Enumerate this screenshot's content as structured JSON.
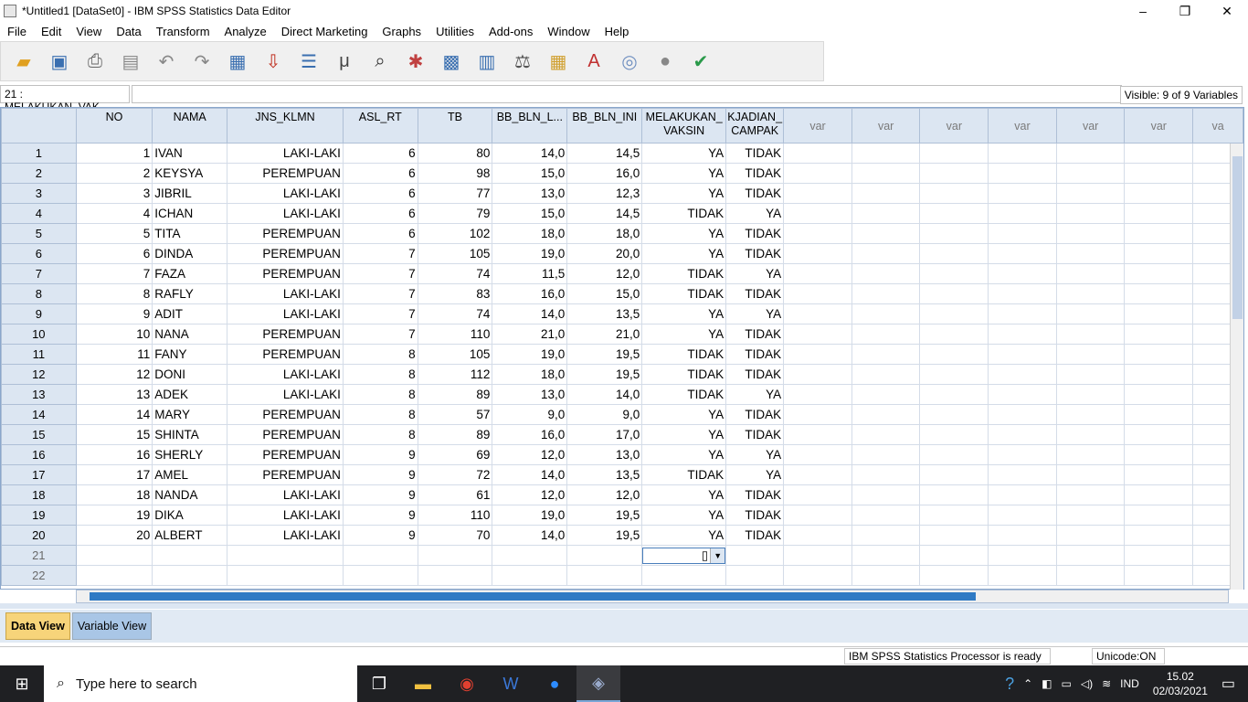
{
  "window": {
    "title": "*Untitled1 [DataSet0] - IBM SPSS Statistics Data Editor",
    "minimize": "–",
    "restore": "❐",
    "close": "✕"
  },
  "menu": [
    "File",
    "Edit",
    "View",
    "Data",
    "Transform",
    "Analyze",
    "Direct Marketing",
    "Graphs",
    "Utilities",
    "Add-ons",
    "Window",
    "Help"
  ],
  "toolbar_icons": [
    "open-folder-icon",
    "save-icon",
    "print-icon",
    "dialog-recall-icon",
    "undo-icon",
    "redo-icon",
    "goto-case-icon",
    "goto-variable-icon",
    "variables-icon",
    "run-descriptives-icon",
    "find-icon",
    "insert-cases-icon",
    "insert-variable-icon",
    "split-file-icon",
    "weight-cases-icon",
    "select-cases-icon",
    "value-labels-icon",
    "use-variable-sets-icon",
    "show-all-variables-icon",
    "spell-check-icon"
  ],
  "cellbar": {
    "ref": "21 : MELAKUKAN_VAK...",
    "value": "",
    "visible": "Visible: 9 of 9 Variables"
  },
  "columns": [
    "NO",
    "NAMA",
    "JNS_KLMN",
    "ASL_RT",
    "TB",
    "BB_BLN_L...",
    "BB_BLN_INI",
    "MELAKUKAN_\nVAKSIN",
    "KJADIAN_\nCAMPAK",
    "var",
    "var",
    "var",
    "var",
    "var",
    "var",
    "va"
  ],
  "rows": [
    [
      "1",
      "IVAN",
      "LAKI-LAKI",
      "6",
      "80",
      "14,0",
      "14,5",
      "YA",
      "TIDAK"
    ],
    [
      "2",
      "KEYSYA",
      "PEREMPUAN",
      "6",
      "98",
      "15,0",
      "16,0",
      "YA",
      "TIDAK"
    ],
    [
      "3",
      "JIBRIL",
      "LAKI-LAKI",
      "6",
      "77",
      "13,0",
      "12,3",
      "YA",
      "TIDAK"
    ],
    [
      "4",
      "ICHAN",
      "LAKI-LAKI",
      "6",
      "79",
      "15,0",
      "14,5",
      "TIDAK",
      "YA"
    ],
    [
      "5",
      "TITA",
      "PEREMPUAN",
      "6",
      "102",
      "18,0",
      "18,0",
      "YA",
      "TIDAK"
    ],
    [
      "6",
      "DINDA",
      "PEREMPUAN",
      "7",
      "105",
      "19,0",
      "20,0",
      "YA",
      "TIDAK"
    ],
    [
      "7",
      "FAZA",
      "PEREMPUAN",
      "7",
      "74",
      "11,5",
      "12,0",
      "TIDAK",
      "YA"
    ],
    [
      "8",
      "RAFLY",
      "LAKI-LAKI",
      "7",
      "83",
      "16,0",
      "15,0",
      "TIDAK",
      "TIDAK"
    ],
    [
      "9",
      "ADIT",
      "LAKI-LAKI",
      "7",
      "74",
      "14,0",
      "13,5",
      "YA",
      "YA"
    ],
    [
      "10",
      "NANA",
      "PEREMPUAN",
      "7",
      "110",
      "21,0",
      "21,0",
      "YA",
      "TIDAK"
    ],
    [
      "11",
      "FANY",
      "PEREMPUAN",
      "8",
      "105",
      "19,0",
      "19,5",
      "TIDAK",
      "TIDAK"
    ],
    [
      "12",
      "DONI",
      "LAKI-LAKI",
      "8",
      "112",
      "18,0",
      "19,5",
      "TIDAK",
      "TIDAK"
    ],
    [
      "13",
      "ADEK",
      "LAKI-LAKI",
      "8",
      "89",
      "13,0",
      "14,0",
      "TIDAK",
      "YA"
    ],
    [
      "14",
      "MARY",
      "PEREMPUAN",
      "8",
      "57",
      "9,0",
      "9,0",
      "YA",
      "TIDAK"
    ],
    [
      "15",
      "SHINTA",
      "PEREMPUAN",
      "8",
      "89",
      "16,0",
      "17,0",
      "YA",
      "TIDAK"
    ],
    [
      "16",
      "SHERLY",
      "PEREMPUAN",
      "9",
      "69",
      "12,0",
      "13,0",
      "YA",
      "YA"
    ],
    [
      "17",
      "AMEL",
      "PEREMPUAN",
      "9",
      "72",
      "14,0",
      "13,5",
      "TIDAK",
      "YA"
    ],
    [
      "18",
      "NANDA",
      "LAKI-LAKI",
      "9",
      "61",
      "12,0",
      "12,0",
      "YA",
      "TIDAK"
    ],
    [
      "19",
      "DIKA",
      "LAKI-LAKI",
      "9",
      "110",
      "19,0",
      "19,5",
      "YA",
      "TIDAK"
    ],
    [
      "20",
      "ALBERT",
      "LAKI-LAKI",
      "9",
      "70",
      "14,0",
      "19,5",
      "YA",
      "TIDAK"
    ]
  ],
  "empty_rows": [
    "21",
    "22"
  ],
  "tabs": {
    "data_view": "Data View",
    "variable_view": "Variable View"
  },
  "status": {
    "processor": "IBM SPSS Statistics Processor is ready",
    "unicode": "Unicode:ON"
  },
  "taskbar": {
    "search_placeholder": "Type here to search",
    "lang": "IND",
    "time": "15.02",
    "date": "02/03/2021"
  }
}
